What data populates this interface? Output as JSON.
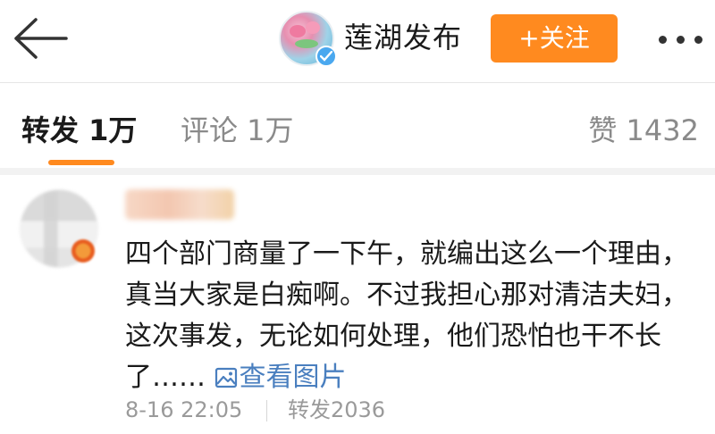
{
  "header": {
    "back_icon": "arrow-left-icon",
    "account_name": "莲湖发布",
    "follow_label": "+关注",
    "more_icon": "more-dots-icon",
    "verified_icon": "verified-badge-icon"
  },
  "tabs": [
    {
      "label": "转发 1万",
      "active": true
    },
    {
      "label": "评论 1万",
      "active": false
    },
    {
      "label": "赞 1432",
      "active": false
    }
  ],
  "comment": {
    "text": "四个部门商量了一下午，就编出这么一个理由，真当大家是白痴啊。不过我担心那对清洁夫妇，这次事发，无论如何处理，他们恐怕也干不长了……",
    "view_images_label": "查看图片",
    "view_images_icon": "image-icon",
    "time": "8-16 22:05",
    "repost_label": "转发2036"
  },
  "colors": {
    "accent": "#ff8a1f",
    "link": "#4a7fbf",
    "muted": "#9a9a9a"
  }
}
